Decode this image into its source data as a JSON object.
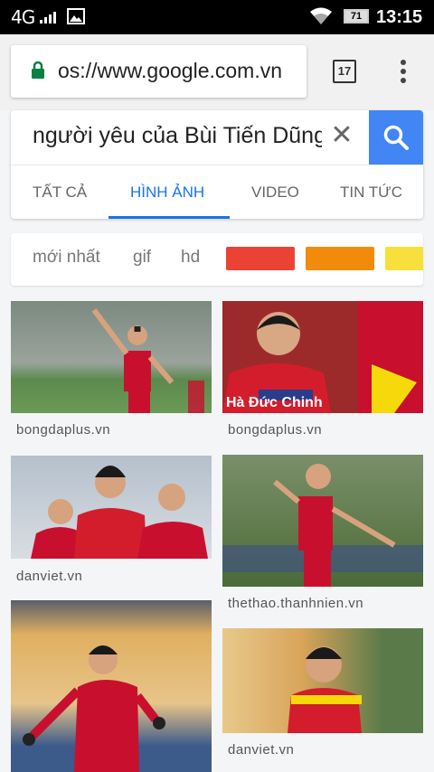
{
  "status_bar": {
    "network": "4G",
    "battery": "71",
    "time": "13:15"
  },
  "browser": {
    "url": "os://www.google.com.vn",
    "tab_count": "17"
  },
  "search": {
    "query": "người yêu của Bùi Tiến Dũng",
    "tabs": [
      {
        "label": "TẤT CẢ",
        "active": false
      },
      {
        "label": "HÌNH ẢNH",
        "active": true
      },
      {
        "label": "VIDEO",
        "active": false
      },
      {
        "label": "TIN TỨC",
        "active": false
      }
    ]
  },
  "filters": {
    "chips": [
      "mới nhất",
      "gif",
      "hd"
    ],
    "colors": [
      "#ea4335",
      "#f28a0b",
      "#f7e03b"
    ]
  },
  "results": [
    {
      "source": "bongdaplus.vn"
    },
    {
      "source": "bongdaplus.vn",
      "overlay": "Hà Đức Chinh"
    },
    {
      "source": "danviet.vn"
    },
    {
      "source": "thethao.thanhnien.vn"
    },
    {
      "source": ""
    },
    {
      "source": "danviet.vn"
    }
  ]
}
